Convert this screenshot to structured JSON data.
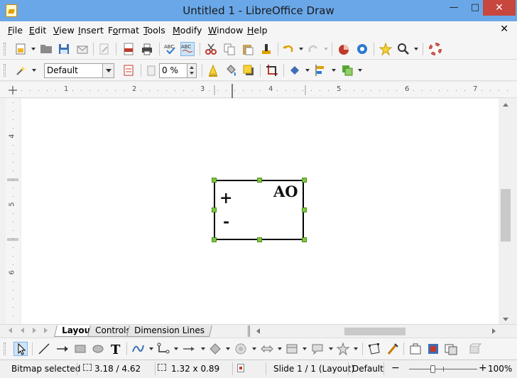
{
  "window": {
    "title": "Untitled 1 - LibreOffice Draw"
  },
  "menubar": {
    "items": [
      "File",
      "Edit",
      "View",
      "Insert",
      "Format",
      "Tools",
      "Modify",
      "Window",
      "Help"
    ],
    "mnemonics": [
      "F",
      "E",
      "V",
      "I",
      "o",
      "T",
      "M",
      "W",
      "H"
    ]
  },
  "standard_toolbar": {
    "icons": [
      "new-icon",
      "open-icon",
      "save-icon",
      "email-icon",
      "edit-mode-icon",
      "export-pdf-icon",
      "print-icon",
      "spellcheck-icon",
      "autospellcheck-icon",
      "cut-icon",
      "copy-icon",
      "paste-icon",
      "clone-formatting-icon",
      "undo-icon",
      "redo-icon",
      "chart-icon",
      "navigator-icon",
      "gallery-star-icon",
      "zoom-icon",
      "help-lifebuoy-icon"
    ]
  },
  "line_fill_toolbar": {
    "style_value": "Default",
    "transparency_value": "0 %"
  },
  "ruler": {
    "h_labels": [
      "1",
      "2",
      "3",
      "4",
      "5",
      "6",
      "7"
    ],
    "v_labels": [
      "4",
      "5",
      "6"
    ]
  },
  "shape": {
    "text_ao": "AO",
    "text_plus": "+",
    "text_minus": "-"
  },
  "tabs": [
    "Layout",
    "Controls",
    "Dimension Lines"
  ],
  "drawing_toolbar": {
    "icons": [
      "select-pointer-icon",
      "line-icon",
      "line-arrow-icon",
      "rectangle-icon",
      "ellipse-icon",
      "text-icon",
      "curve-icon",
      "connector-icon",
      "lines-arrows-icon",
      "basic-shapes-icon",
      "symbol-shapes-icon",
      "block-arrows-icon",
      "flowchart-icon",
      "callouts-icon",
      "stars-icon",
      "points-icon",
      "glue-points-icon",
      "fontwork-icon",
      "from-file-icon",
      "gallery-icon",
      "extrusion-icon"
    ]
  },
  "statusbar": {
    "selection": "Bitmap selected",
    "position": "3.18 / 4.62",
    "size": "1.32 x 0.89",
    "slide": "Slide 1 / 1 (Layout)",
    "master": "Default",
    "zoom": "100%"
  }
}
